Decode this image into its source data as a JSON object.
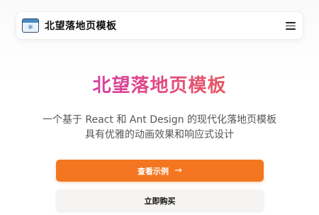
{
  "navbar": {
    "brand": "北望落地页模板",
    "logo_icon": "browser-window-icon",
    "menu_icon": "hamburger-menu-icon"
  },
  "hero": {
    "title": "北望落地页模板",
    "subtitle_line1": "一个基于 React 和 Ant Design 的现代化落地页模板",
    "subtitle_line2": "具有优雅的动画效果和响应式设计",
    "gradient_colors": [
      "#c23ad6",
      "#e0458a",
      "#f07030"
    ]
  },
  "actions": {
    "primary_label": "查看示例",
    "primary_arrow": "→",
    "secondary_label": "立即购买",
    "primary_color": "#f47620"
  }
}
